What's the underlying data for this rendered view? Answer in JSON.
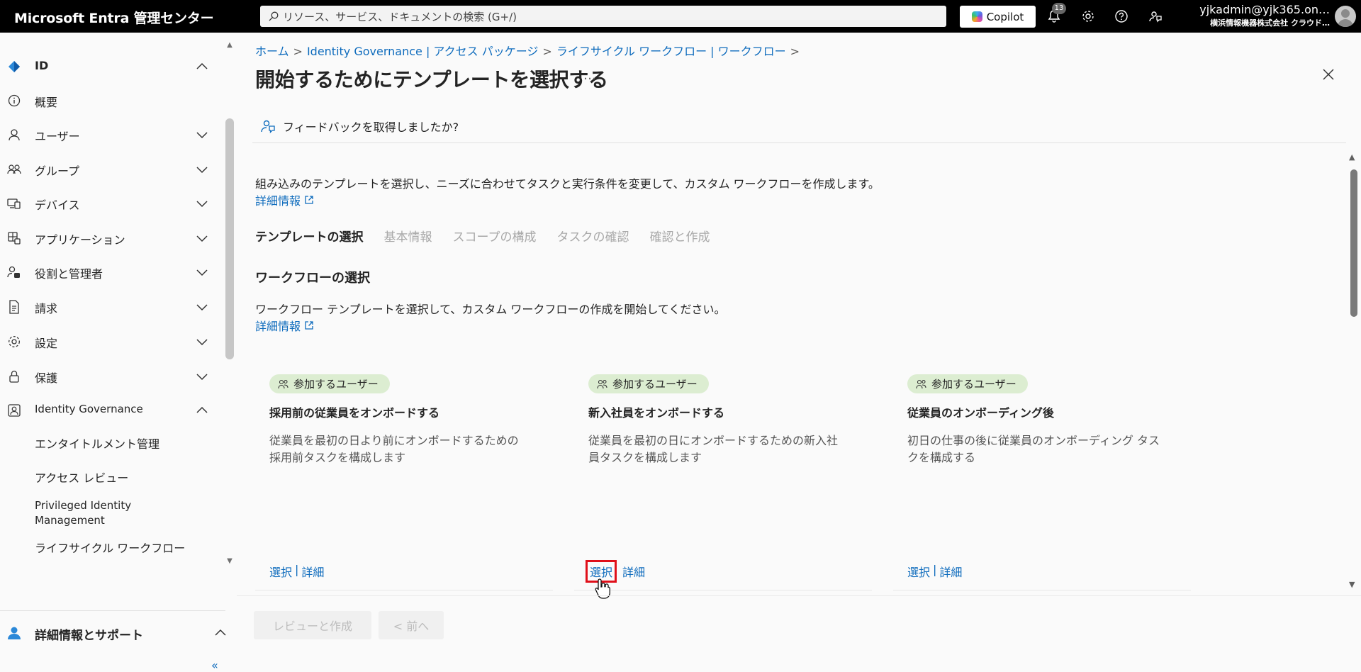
{
  "topbar": {
    "brand": "Microsoft Entra 管理センター",
    "search_placeholder": "リソース、サービス、ドキュメントの検索 (G+/)",
    "copilot_label": "Copilot",
    "notification_count": "13",
    "user_email": "yjkadmin@yjk365.on…",
    "user_org": "横浜情報機器株式会社 クラウド…"
  },
  "sidebar": {
    "items": [
      {
        "label": "ID",
        "icon": "diamond-icon"
      },
      {
        "label": "概要",
        "icon": "info-icon"
      },
      {
        "label": "ユーザー",
        "icon": "person-icon"
      },
      {
        "label": "グループ",
        "icon": "group-icon"
      },
      {
        "label": "デバイス",
        "icon": "device-icon"
      },
      {
        "label": "アプリケーション",
        "icon": "apps-icon"
      },
      {
        "label": "役割と管理者",
        "icon": "roles-icon"
      },
      {
        "label": "請求",
        "icon": "billing-icon"
      },
      {
        "label": "設定",
        "icon": "gear-icon"
      },
      {
        "label": "保護",
        "icon": "lock-icon"
      },
      {
        "label": "Identity Governance",
        "icon": "governance-icon"
      }
    ],
    "sub_items": [
      "エンタイトルメント管理",
      "アクセス レビュー",
      "Privileged Identity Management",
      "ライフサイクル ワークフロー"
    ],
    "help_label": "詳細情報とサポート",
    "collapse_label": "«"
  },
  "breadcrumb": {
    "items": [
      "ホーム",
      "Identity Governance | アクセス パッケージ",
      "ライフサイクル ワークフロー | ワークフロー"
    ]
  },
  "page": {
    "title": "開始するためにテンプレートを選択する",
    "more": "…",
    "feedback": "フィードバックを取得しましたか?",
    "description": "組み込みのテンプレートを選択し、ニーズに合わせてタスクと実行条件を変更して、カスタム ワークフローを作成します。",
    "more_info": "詳細情報",
    "tabs": [
      "テンプレートの選択",
      "基本情報",
      "スコープの構成",
      "タスクの確認",
      "確認と作成"
    ],
    "section_title": "ワークフローの選択",
    "section_desc": "ワークフロー テンプレートを選択して、カスタム ワークフローの作成を開始してください。",
    "more_info_2": "詳細情報"
  },
  "cards": [
    {
      "tag": "参加するユーザー",
      "title": "採用前の従業員をオンボードする",
      "desc": "従業員を最初の日より前にオンボードするための採用前タスクを構成します",
      "select": "選択",
      "detail": "詳細"
    },
    {
      "tag": "参加するユーザー",
      "title": "新入社員をオンボードする",
      "desc": "従業員を最初の日にオンボードするための新入社員タスクを構成します",
      "select": "選択",
      "detail": "詳細"
    },
    {
      "tag": "参加するユーザー",
      "title": "従業員のオンボーディング後",
      "desc": "初日の仕事の後に従業員のオンボーディング タスクを構成する",
      "select": "選択",
      "detail": "詳細"
    }
  ],
  "footer": {
    "review_create": "レビューと作成",
    "prev": "< 前へ"
  },
  "colors": {
    "accent": "#0f6cbd",
    "highlight": "#e0101a",
    "pill": "#dcedd1"
  }
}
